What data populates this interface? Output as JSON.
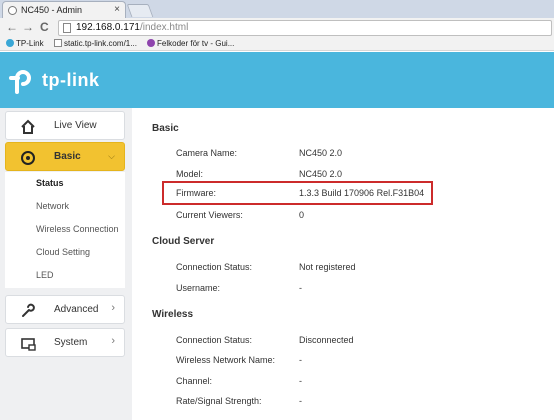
{
  "browser": {
    "tab_title": "NC450 - Admin",
    "tab_close": "×",
    "nav_back": "←",
    "nav_forward": "→",
    "nav_reload": "C",
    "url_host": "192.168.0.171",
    "url_path": "/index.html",
    "bookmarks": [
      {
        "label": "TP-Link"
      },
      {
        "label": "static.tp-link.com/1..."
      },
      {
        "label": "Felkoder för tv - Gui..."
      }
    ]
  },
  "header": {
    "brand": "tp-link"
  },
  "sidebar": {
    "items": [
      {
        "label": "Live View",
        "icon": "home-icon"
      },
      {
        "label": "Basic",
        "icon": "camera-icon",
        "chevron": "⌵"
      },
      {
        "label": "Advanced",
        "icon": "wrench-icon",
        "chevron": "›"
      },
      {
        "label": "System",
        "icon": "system-icon",
        "chevron": "›"
      }
    ],
    "sub_items": [
      "Status",
      "Network",
      "Wireless Connection",
      "Cloud Setting",
      "LED"
    ]
  },
  "main": {
    "basic": {
      "title": "Basic",
      "rows": [
        {
          "label": "Camera Name:",
          "value": "NC450 2.0"
        },
        {
          "label": "Model:",
          "value": "NC450 2.0"
        },
        {
          "label": "Firmware:",
          "value": "1.3.3 Build 170906 Rel.F31B04"
        },
        {
          "label": "Current Viewers:",
          "value": "0"
        }
      ]
    },
    "cloud": {
      "title": "Cloud Server",
      "rows": [
        {
          "label": "Connection Status:",
          "value": "Not registered"
        },
        {
          "label": "Username:",
          "value": "-"
        }
      ]
    },
    "wireless": {
      "title": "Wireless",
      "rows": [
        {
          "label": "Connection Status:",
          "value": "Disconnected"
        },
        {
          "label": "Wireless Network Name:",
          "value": "-"
        },
        {
          "label": "Channel:",
          "value": "-"
        },
        {
          "label": "Rate/Signal Strength:",
          "value": "-"
        }
      ]
    }
  },
  "colors": {
    "header_bg": "#4ab6dd",
    "active_nav": "#f2c230",
    "highlight_border": "#cc2b2b"
  }
}
